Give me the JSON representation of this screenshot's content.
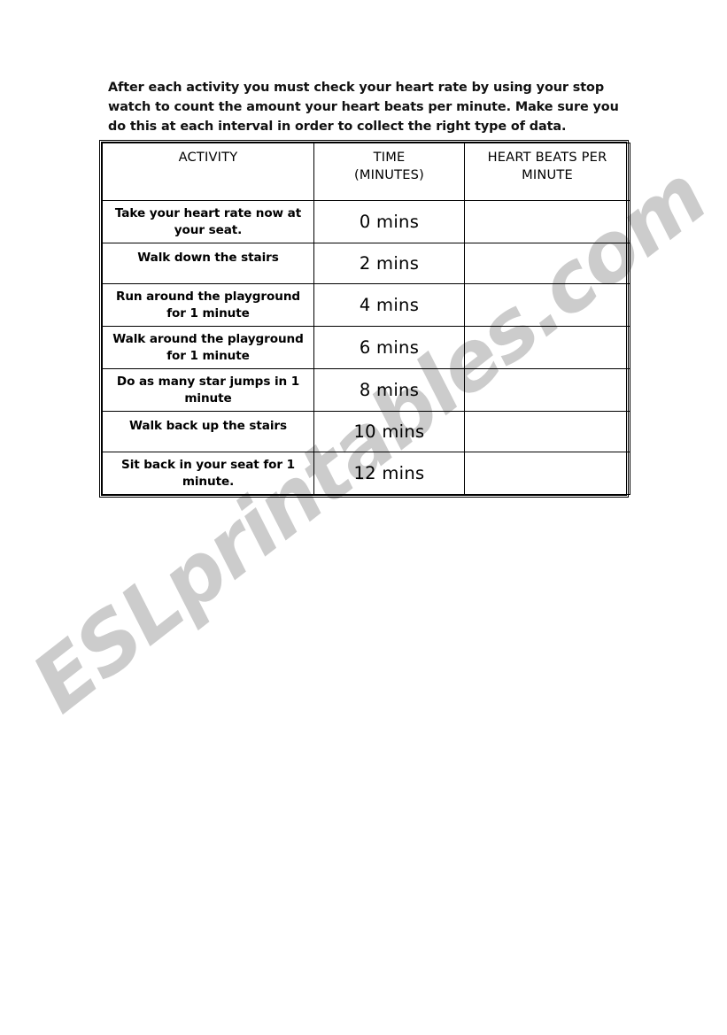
{
  "document": {
    "intro_paragraph": "After each activity you must check your heart rate by using your stop watch to count the amount your heart beats per minute. Make sure you do this at each interval in order to collect the right type of data.",
    "watermark": "ESLprintables.com",
    "watermark_color": "#cccccc",
    "page_background": "#ffffff",
    "ink_color": "#000000"
  },
  "table": {
    "headers": {
      "activity": "ACTIVITY",
      "time_line1": "TIME",
      "time_line2": "(MINUTES)",
      "bpm_line1": "HEART BEATS PER",
      "bpm_line2": "MINUTE"
    },
    "rows": [
      {
        "activity_line1": "Take your heart rate now at",
        "activity_line2": "your seat.",
        "time": "0 mins",
        "bpm": ""
      },
      {
        "activity_line1": "Walk down the stairs",
        "activity_line2": "",
        "time": "2 mins",
        "bpm": ""
      },
      {
        "activity_line1": "Run around the playground",
        "activity_line2": "for 1 minute",
        "time": "4 mins",
        "bpm": ""
      },
      {
        "activity_line1": "Walk around the playground",
        "activity_line2": "for 1 minute",
        "time": "6 mins",
        "bpm": ""
      },
      {
        "activity_line1": "Do as many star jumps in 1",
        "activity_line2": "minute",
        "time": "8 mins",
        "bpm": ""
      },
      {
        "activity_line1": "Walk back up the stairs",
        "activity_line2": "",
        "time": "10 mins",
        "bpm": ""
      },
      {
        "activity_line1": "Sit back in your seat for 1",
        "activity_line2": "minute.",
        "time": "12 mins",
        "bpm": ""
      }
    ]
  }
}
